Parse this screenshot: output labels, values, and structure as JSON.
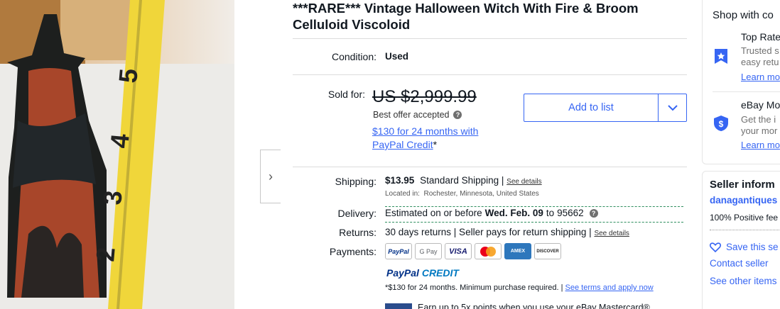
{
  "listing": {
    "title": "***RARE*** Vintage Halloween Witch With Fire & Broom Celluloid Viscoloid",
    "condition_label": "Condition:",
    "condition_value": "Used",
    "sold_for_label": "Sold for:",
    "price": "US $2,999.99",
    "best_offer": "Best offer accepted",
    "paypal_credit_line1": "$130 for 24 months with",
    "paypal_credit_line2": "PayPal Credit",
    "paypal_credit_star": "*",
    "add_to_list": "Add to list"
  },
  "shipping": {
    "label": "Shipping:",
    "cost": "$13.95",
    "method": "Standard Shipping |",
    "see_details": "See details",
    "located_label": "Located in:",
    "located_value": "Rochester, Minnesota, United States"
  },
  "delivery": {
    "label": "Delivery:",
    "prefix": "Estimated on or before",
    "date": "Wed. Feb. 09",
    "to": "to",
    "zip": "95662"
  },
  "returns": {
    "label": "Returns:",
    "text": "30 days returns | Seller pays for return shipping |",
    "see_details": "See details"
  },
  "payments": {
    "label": "Payments:",
    "methods": [
      "PayPal",
      "G Pay",
      "VISA",
      "Mastercard",
      "AMEX",
      "DISCOVER"
    ],
    "paypal_credit_logo_a": "PayPal",
    "paypal_credit_logo_b": "CREDIT",
    "fine_print": "*$130 for 24 months. Minimum purchase required. |",
    "fine_link": "See terms and apply now",
    "mastercard_promo": "Earn up to 5x points when you use your eBay Mastercard®"
  },
  "sidebar": {
    "shop_title": "Shop with co",
    "top_rated_title": "Top Rate",
    "top_rated_sub1": "Trusted s",
    "top_rated_sub2": "easy retu",
    "top_rated_link": "Learn mo",
    "money_back_title": "eBay Mo",
    "money_back_sub1": "Get the i",
    "money_back_sub2": "your mor",
    "money_back_link": "Learn mo",
    "seller_title": "Seller inform",
    "seller_name": "danagantiques",
    "feedback": "100% Positive fee",
    "save_seller": "Save this se",
    "contact_seller": "Contact seller",
    "see_other": "See other items"
  },
  "colors": {
    "link": "#3665f3",
    "text": "#111820",
    "accent_dashed": "#2f8f5f"
  }
}
